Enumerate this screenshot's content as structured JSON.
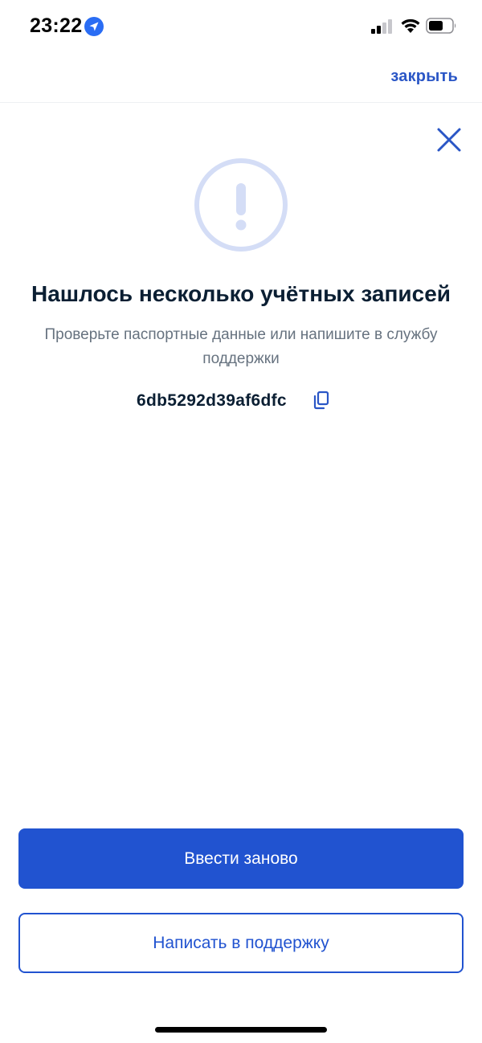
{
  "status_bar": {
    "time": "23:22",
    "icons": [
      "location-arrow-icon",
      "signal-icon",
      "wifi-icon",
      "battery-icon"
    ]
  },
  "header": {
    "close_label": "закрыть"
  },
  "dialog": {
    "title": "Нашлось несколько учётных записей",
    "subtitle": "Проверьте паспортные данные или напишите в службу поддержки",
    "code": "6db5292d39af6dfc",
    "icons": [
      "close-icon",
      "exclamation-circle-icon",
      "copy-icon"
    ]
  },
  "actions": {
    "retry_label": "Ввести заново",
    "support_label": "Написать в поддержку"
  },
  "colors": {
    "accent": "#2153d0",
    "link": "#2a56c6",
    "alert_circle": "#d4ddf6",
    "text_primary": "#0b1f33",
    "text_secondary": "#66727f"
  }
}
